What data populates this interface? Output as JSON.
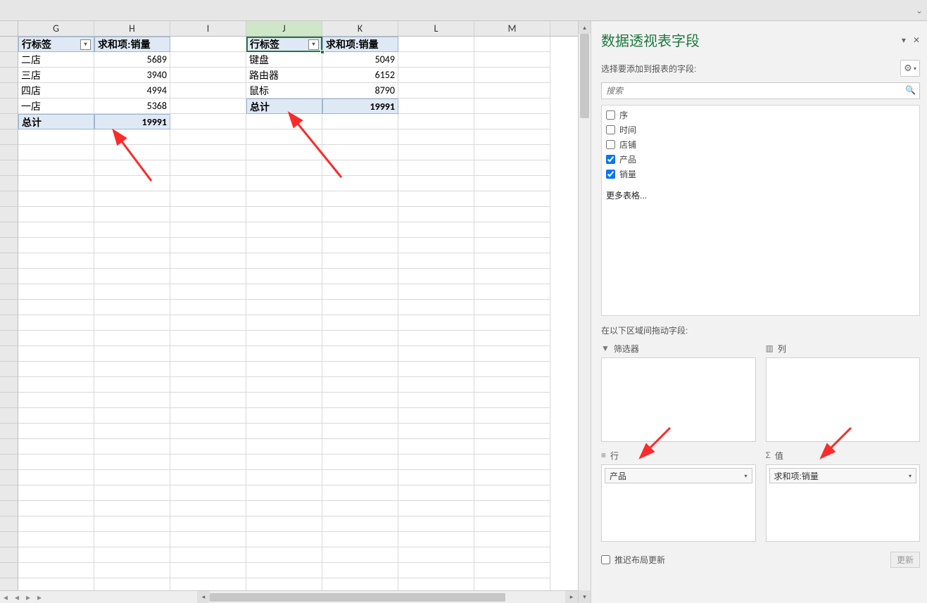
{
  "columns": [
    "G",
    "H",
    "I",
    "J",
    "K",
    "L",
    "M"
  ],
  "selected_column": "J",
  "pivot1": {
    "row_header": "行标签",
    "value_header": "求和项:销量",
    "rows": [
      {
        "label": "二店",
        "value": 5689
      },
      {
        "label": "三店",
        "value": 3940
      },
      {
        "label": "四店",
        "value": 4994
      },
      {
        "label": "一店",
        "value": 5368
      }
    ],
    "total_label": "总计",
    "total_value": 19991
  },
  "pivot2": {
    "row_header": "行标签",
    "value_header": "求和项:销量",
    "rows": [
      {
        "label": "键盘",
        "value": 5049
      },
      {
        "label": "路由器",
        "value": 6152
      },
      {
        "label": "鼠标",
        "value": 8790
      }
    ],
    "total_label": "总计",
    "total_value": 19991
  },
  "panel": {
    "title": "数据透视表字段",
    "subtitle": "选择要添加到报表的字段:",
    "search_placeholder": "搜索",
    "fields": [
      {
        "name": "序",
        "checked": false
      },
      {
        "name": "时间",
        "checked": false
      },
      {
        "name": "店铺",
        "checked": false
      },
      {
        "name": "产品",
        "checked": true
      },
      {
        "name": "销量",
        "checked": true
      }
    ],
    "more_tables": "更多表格...",
    "drag_label": "在以下区域间拖动字段:",
    "areas": {
      "filter": {
        "title": "筛选器",
        "items": []
      },
      "columns": {
        "title": "列",
        "items": []
      },
      "rows": {
        "title": "行",
        "items": [
          "产品"
        ]
      },
      "values": {
        "title": "值",
        "items": [
          "求和项:销量"
        ]
      }
    },
    "defer_label": "推迟布局更新",
    "update_button": "更新"
  }
}
